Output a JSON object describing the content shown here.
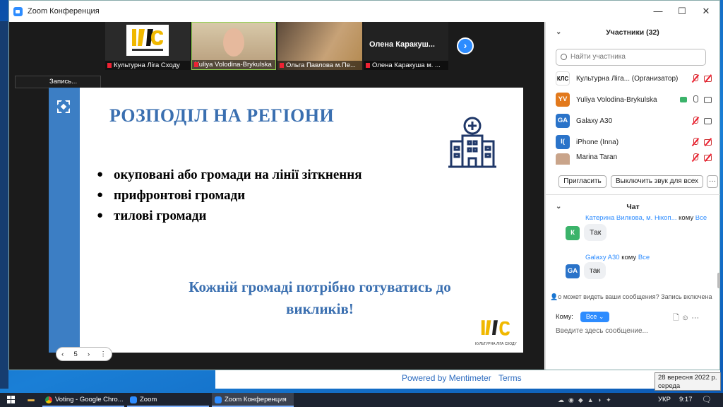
{
  "window": {
    "title": "Zoom Конференция"
  },
  "video_strip": [
    {
      "name": "Культурна Ліга Сходу"
    },
    {
      "name": "Yuliya Volodina-Brykulska"
    },
    {
      "name": "Ольга Павлова м.Пе..."
    },
    {
      "name": "Олена Каракуша м. ...",
      "big_label": "Олена  Каракуш..."
    }
  ],
  "recording": {
    "label": "Запись..."
  },
  "slide": {
    "title": "РОЗПОДІЛ НА РЕГІОНИ",
    "bullets": [
      "окуповані або громади на лінії зіткнення",
      "прифронтові громади",
      "тилові громади"
    ],
    "footer_line1": "Кожній громаді потрібно готуватись до",
    "footer_line2": "викликів!",
    "logo_text": "КУЛЬТУРНА ЛІГА СХОДУ",
    "logo_letters": "КЛС"
  },
  "pager": {
    "prev": "‹",
    "page": "5",
    "next": "›",
    "more": "⋮"
  },
  "participants": {
    "header": "Участники (32)",
    "search_placeholder": "Найти участника",
    "list": [
      {
        "initials": "",
        "name": "Культурна Ліга... (Организатор)",
        "color": "#ffffff"
      },
      {
        "initials": "YV",
        "name": "Yuliya Volodina-Brykulska",
        "color": "#e2791c"
      },
      {
        "initials": "GA",
        "name": "Galaxy A30",
        "color": "#2a73c9"
      },
      {
        "initials": "I(",
        "name": "iPhone (Inna)",
        "color": "#2a73c9"
      },
      {
        "initials": "",
        "name": "Marina Taran",
        "color": "#c9a48a"
      }
    ],
    "invite_label": "Пригласить",
    "mute_all_label": "Выключить звук для всех",
    "more_label": "···"
  },
  "chat": {
    "header": "Чат",
    "messages": [
      {
        "avatar": "К",
        "avatar_color": "#3bb36a",
        "sender": "Катерина Вилкова, м. Нікоп...",
        "to": "кому",
        "to_target": "Все",
        "text": "Так"
      },
      {
        "avatar": "GA",
        "avatar_color": "#2a73c9",
        "sender": "Galaxy A30",
        "to": "кому",
        "to_target": "Все",
        "text": "так"
      }
    ],
    "privacy_note": "о может видеть ваши сообщения? Запись включена",
    "to_label": "Кому:",
    "to_value": "Все",
    "input_placeholder": "Введите здесь сообщение..."
  },
  "footer": {
    "powered": "Powered by Mentimeter",
    "terms": "Terms"
  },
  "date_popup": {
    "line1": "28 вересня 2022 р.",
    "line2": "середа"
  },
  "taskbar": {
    "apps": [
      {
        "label": "Voting - Google Chro..."
      },
      {
        "label": "Zoom"
      },
      {
        "label": "Zoom Конференция"
      }
    ],
    "lang": "УКР",
    "time": "9:17"
  }
}
